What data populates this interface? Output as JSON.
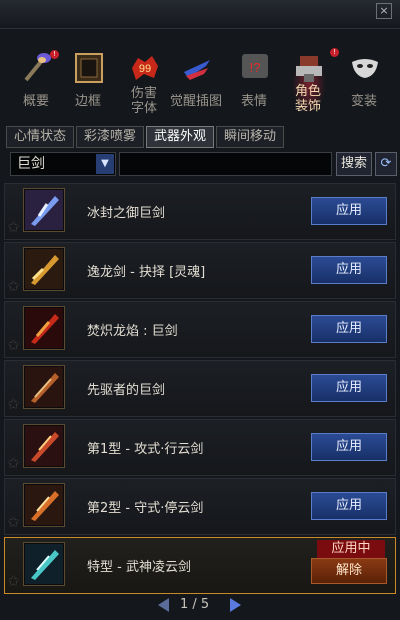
{
  "window": {
    "title": "",
    "close_label": "×"
  },
  "top_menu": [
    {
      "label": "概要",
      "badge": "!"
    },
    {
      "label": "边框",
      "badge": ""
    },
    {
      "label": "伤害\n字体",
      "badge": "",
      "icon_text": "99"
    },
    {
      "label": "觉醒插图",
      "badge": ""
    },
    {
      "label": "表情",
      "badge": "",
      "icon_text": "!?"
    },
    {
      "label": "角色\n装饰",
      "badge": "!"
    },
    {
      "label": "变装",
      "badge": ""
    }
  ],
  "tabs": [
    {
      "label": "心情状态"
    },
    {
      "label": "彩漆喷雾"
    },
    {
      "label": "武器外观"
    },
    {
      "label": "瞬间移动"
    }
  ],
  "filter": {
    "selected": "巨剑",
    "search_label": "搜索",
    "search_value": ""
  },
  "items": [
    {
      "name": "冰封之御巨剑",
      "action": "应用"
    },
    {
      "name": "逸龙剑 - 抉择 [灵魂]",
      "action": "应用"
    },
    {
      "name": "焚炽龙焰 : 巨剑",
      "action": "应用"
    },
    {
      "name": "先驱者的巨剑",
      "action": "应用"
    },
    {
      "name": "第1型 - 攻式·行云剑",
      "action": "应用"
    },
    {
      "name": "第2型 - 守式·停云剑",
      "action": "应用"
    },
    {
      "name": "特型 - 武神凌云剑",
      "status": "应用中",
      "action": "解除"
    }
  ],
  "pager": {
    "text": "1 / 5"
  }
}
